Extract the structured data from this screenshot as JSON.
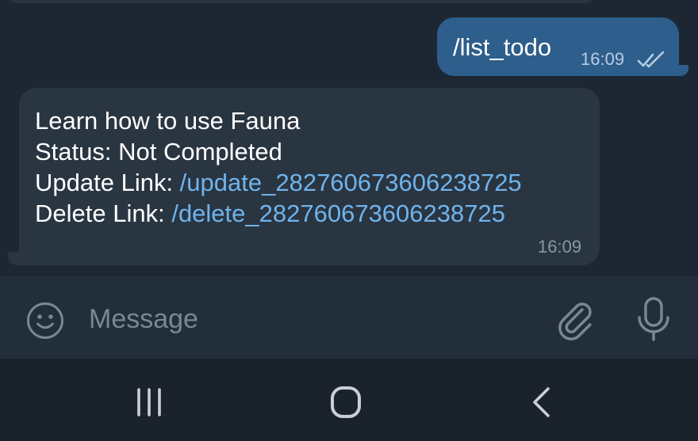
{
  "outgoing_message": {
    "text": "/list_todo",
    "time": "16:09",
    "status_icon": "double-check-icon"
  },
  "incoming_message": {
    "line1": "Learn how to use Fauna",
    "line2": "Status: Not Completed",
    "update_label": "Update Link: ",
    "update_link": "/update_282760673606238725",
    "delete_label": "Delete Link: ",
    "delete_link": "/delete_282760673606238725",
    "time": "16:09"
  },
  "composer": {
    "placeholder": "Message",
    "emoji_icon": "emoji-icon",
    "attach_icon": "paperclip-icon",
    "mic_icon": "microphone-icon"
  },
  "navbar": {
    "recents_icon": "recents-icon",
    "home_icon": "home-icon",
    "back_icon": "back-icon"
  },
  "colors": {
    "background": "#1d2733",
    "outgoing_bubble": "#2e5e8b",
    "incoming_bubble": "#2a3542",
    "link": "#6fb4ec",
    "composer": "#232e3b",
    "navbar": "#1a222c"
  }
}
